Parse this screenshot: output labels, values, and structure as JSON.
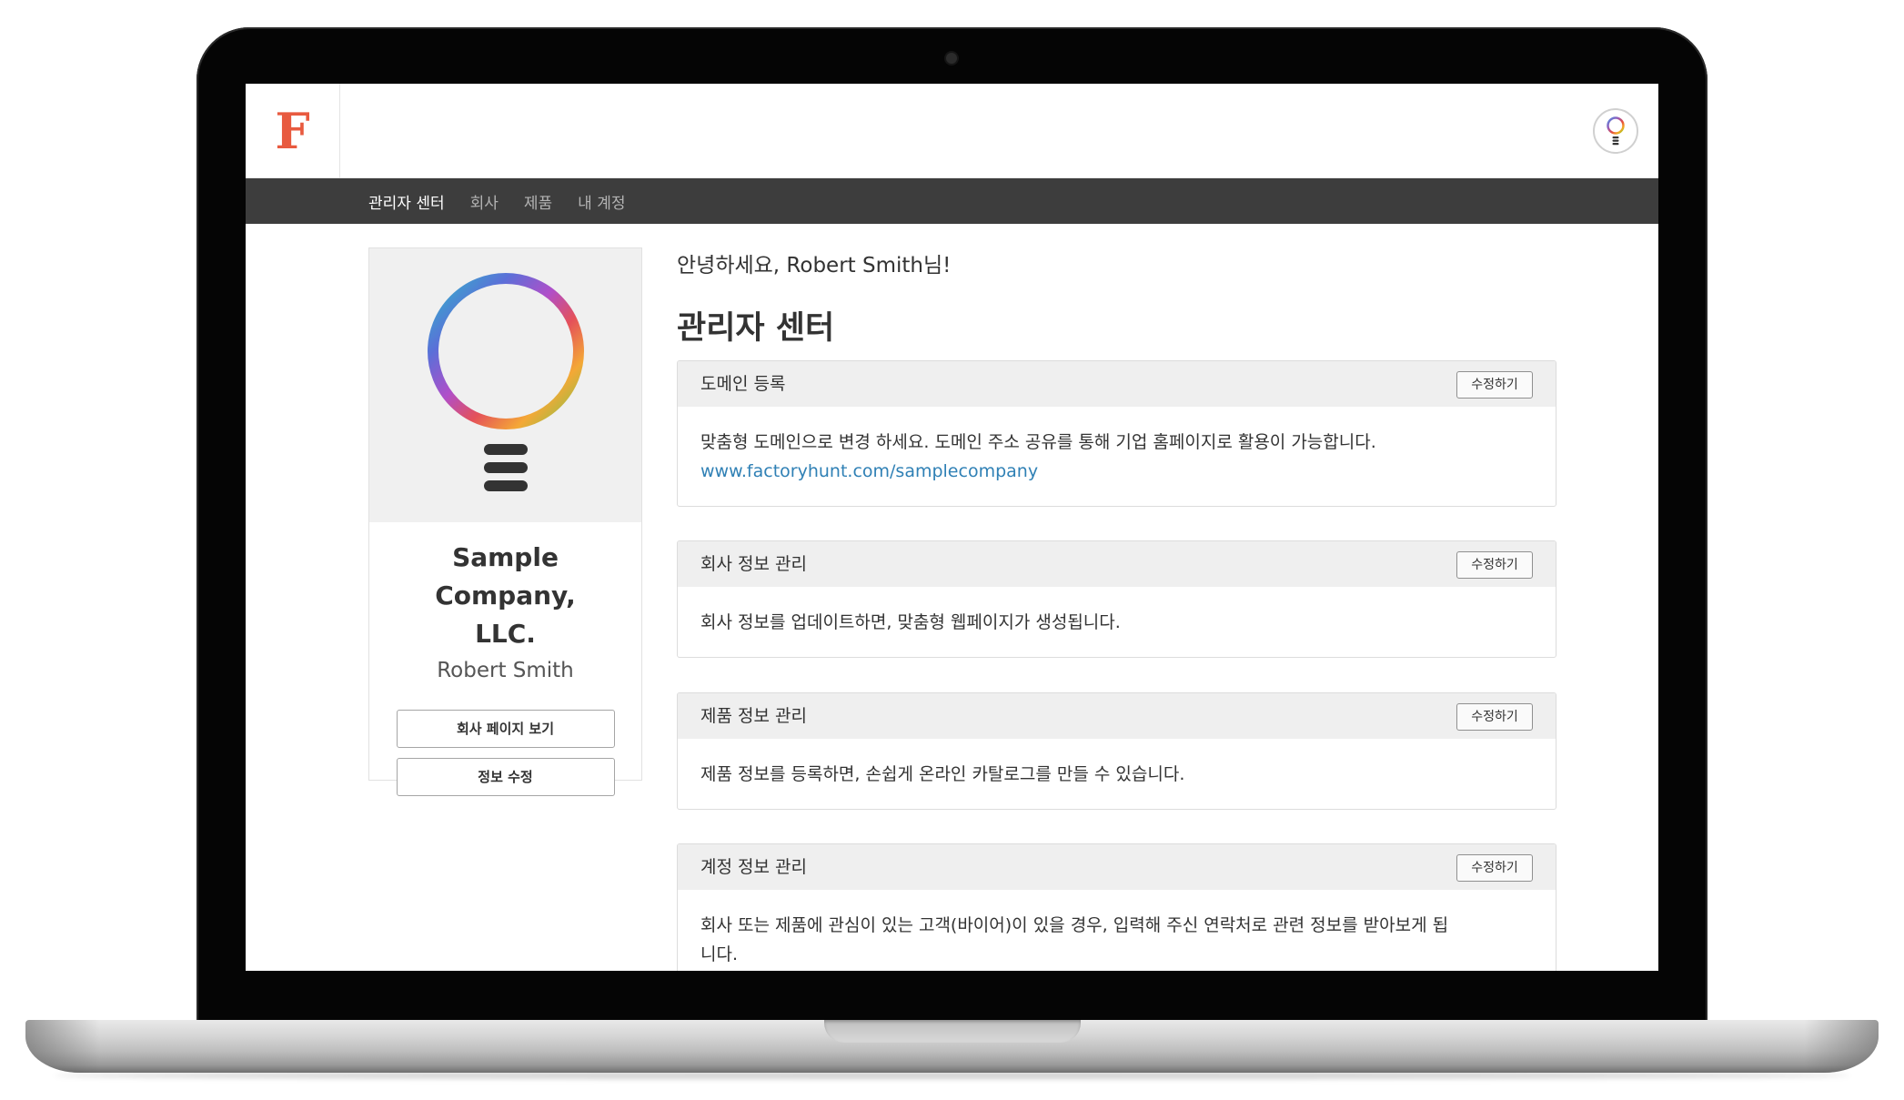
{
  "header": {
    "logo": "F"
  },
  "nav": {
    "items": [
      "관리자 센터",
      "회사",
      "제품",
      "내 계정"
    ],
    "active_index": 0
  },
  "profile": {
    "company_name_line1": "Sample Company,",
    "company_name_line2": "LLC.",
    "person_name": "Robert Smith",
    "view_page_button": "회사 페이지 보기",
    "edit_info_button": "정보 수정"
  },
  "main": {
    "greeting": "안녕하세요, Robert Smith님!",
    "title": "관리자 센터",
    "panels": [
      {
        "title": "도메인 등록",
        "button": "수정하기",
        "body": "맞춤형 도메인으로 변경 하세요. 도메인 주소 공유를 통해 기업 홈페이지로 활용이 가능합니다.",
        "link": "www.factoryhunt.com/samplecompany"
      },
      {
        "title": "회사 정보 관리",
        "button": "수정하기",
        "body": "회사 정보를 업데이트하면, 맞춤형 웹페이지가 생성됩니다."
      },
      {
        "title": "제품 정보 관리",
        "button": "수정하기",
        "body": "제품 정보를 등록하면, 손쉽게 온라인 카탈로그를 만들 수 있습니다."
      },
      {
        "title": "계정 정보 관리",
        "button": "수정하기",
        "body_line1": "회사 또는 제품에 관심이 있는 고객(바이어)이 있을 경우, 입력해 주신 연락처로 관련 정보를 받아보게 됩",
        "body_line2": "니다."
      }
    ]
  },
  "colors": {
    "logo": "#e85a3f",
    "navbar": "#3d3d3d",
    "link": "#2f80b5",
    "panel_header": "#efefef"
  },
  "icons": {
    "avatar": "lightbulb-icon",
    "profile_image": "rainbow-lightbulb-icon",
    "camera": "webcam-dot"
  }
}
